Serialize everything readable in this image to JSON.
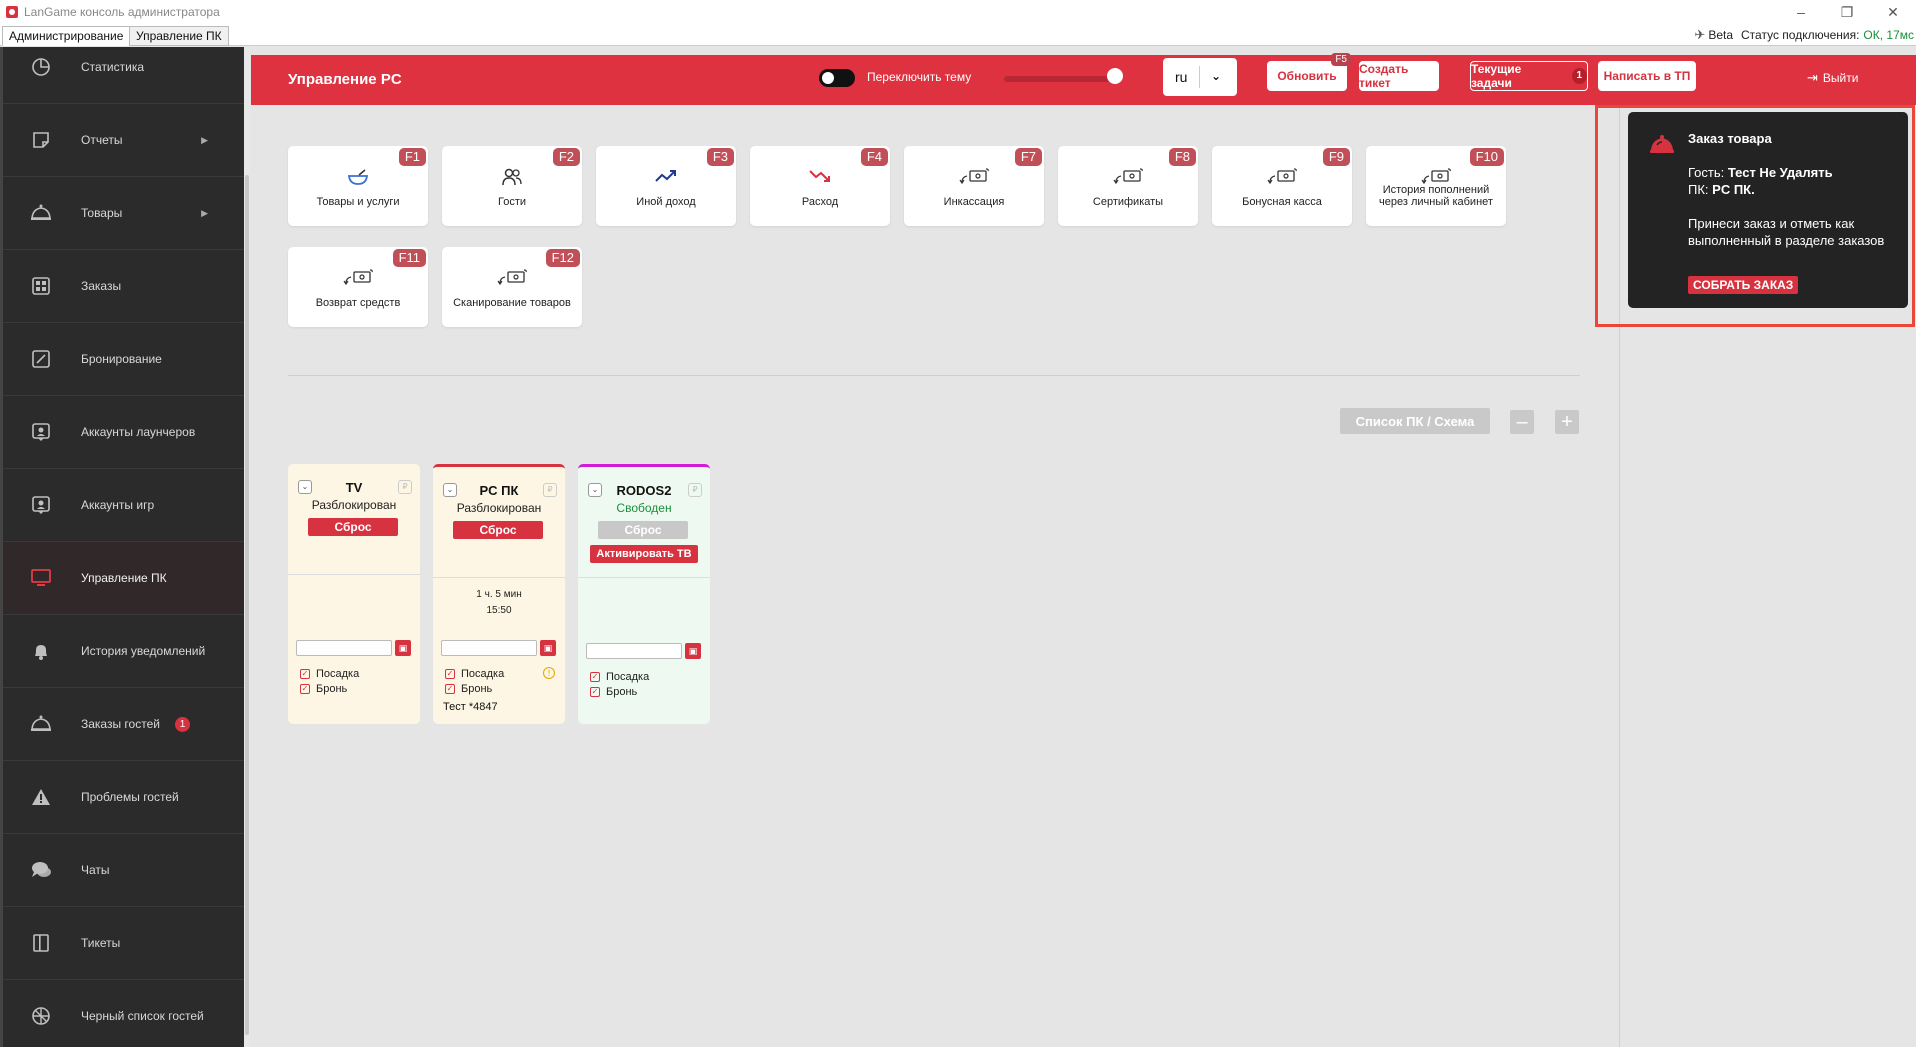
{
  "window": {
    "title": "LanGame консоль администратора",
    "tabs": [
      "Администрирование",
      "Управление ПК"
    ],
    "beta_label": "Beta",
    "status_label": "Статус подключения:",
    "status_value": "ОК, 17мс"
  },
  "sidebar": {
    "items": [
      {
        "label": "Статистика",
        "icon": "chart-icon"
      },
      {
        "label": "Отчеты",
        "icon": "report-icon",
        "arrow": "▶"
      },
      {
        "label": "Товары",
        "icon": "cloche-icon",
        "arrow": "▶"
      },
      {
        "label": "Заказы",
        "icon": "grid-icon"
      },
      {
        "label": "Бронирование",
        "icon": "edit-icon"
      },
      {
        "label": "Аккаунты лаунчеров",
        "icon": "account-icon"
      },
      {
        "label": "Аккаунты игр",
        "icon": "account-icon"
      },
      {
        "label": "Управление ПК",
        "icon": "monitor-icon"
      },
      {
        "label": "История уведомлений",
        "icon": "bell-icon"
      },
      {
        "label": "Заказы гостей",
        "icon": "cloche-icon",
        "badge": "1"
      },
      {
        "label": "Проблемы гостей",
        "icon": "warning-icon"
      },
      {
        "label": "Чаты",
        "icon": "chat-icon"
      },
      {
        "label": "Тикеты",
        "icon": "ticket-icon"
      },
      {
        "label": "Черный список гостей",
        "icon": "ban-icon"
      }
    ],
    "active_index": 7
  },
  "header": {
    "title": "Управление PC",
    "theme_toggle_label": "Переключить тему",
    "language": "ru",
    "refresh_label": "Обновить",
    "refresh_key": "F5",
    "create_ticket_label": "Создать тикет",
    "current_tasks_label": "Текущие задачи",
    "current_tasks_count": "1",
    "write_support_label": "Написать в ТП",
    "logout_label": "Выйти"
  },
  "tiles": [
    {
      "label": "Товары и услуги",
      "key": "F1",
      "icon": "bowl-icon"
    },
    {
      "label": "Гости",
      "key": "F2",
      "icon": "users-icon"
    },
    {
      "label": "Иной доход",
      "key": "F3",
      "icon": "trend-up-icon"
    },
    {
      "label": "Расход",
      "key": "F4",
      "icon": "trend-down-icon"
    },
    {
      "label": "Инкассация",
      "key": "F7",
      "icon": "money-transfer-icon"
    },
    {
      "label": "Сертификаты",
      "key": "F8",
      "icon": "money-transfer-icon"
    },
    {
      "label": "Бонусная касса",
      "key": "F9",
      "icon": "money-transfer-icon"
    },
    {
      "label": "История пополнений через личный кабинет",
      "key": "F10",
      "icon": "money-transfer-icon"
    },
    {
      "label": "Возврат средств",
      "key": "F11",
      "icon": "money-transfer-icon"
    },
    {
      "label": "Сканирование товаров",
      "key": "F12",
      "icon": "money-transfer-icon"
    }
  ],
  "view_controls": {
    "list_label": "Список ПК / Схема",
    "zoom_out": "–",
    "zoom_in": "+"
  },
  "pcs": [
    {
      "name": "TV",
      "state": "Разблокирован",
      "reset_label": "Сброс",
      "bg": "#fdf6e4",
      "border_top": "",
      "option_1": "Посадка",
      "option_2": "Бронь"
    },
    {
      "name": "PC ПК",
      "state": "Разблокирован",
      "reset_label": "Сброс",
      "bg": "#fdf6e4",
      "border_top": "#d6323f",
      "time_line_1": "1 ч. 5 мин",
      "time_line_2": "15:50",
      "option_1": "Посадка",
      "option_2": "Бронь",
      "guest": "Тест *4847"
    },
    {
      "name": "RODOS2",
      "state": "Свободен",
      "reset_label": "Сброс",
      "activate_label": "Активировать ТВ",
      "bg": "#eefaf1",
      "border_top": "#d21bd6",
      "option_1": "Посадка",
      "option_2": "Бронь"
    }
  ],
  "notification": {
    "title": "Заказ товара",
    "guest_prefix": "Гость:",
    "guest_value": "Тест Не Удалять",
    "pc_prefix": "ПК:",
    "pc_value": "PC ПК.",
    "message": "Принеси заказ и отметь как выполненный в разделе заказов",
    "action_label": "СОБРАТЬ ЗАКАЗ"
  },
  "colors": {
    "accent": "#de3241",
    "sidebar_bg": "#2b2b2b",
    "notif_bg": "#232323",
    "highlight_frame": "#e8473a"
  }
}
